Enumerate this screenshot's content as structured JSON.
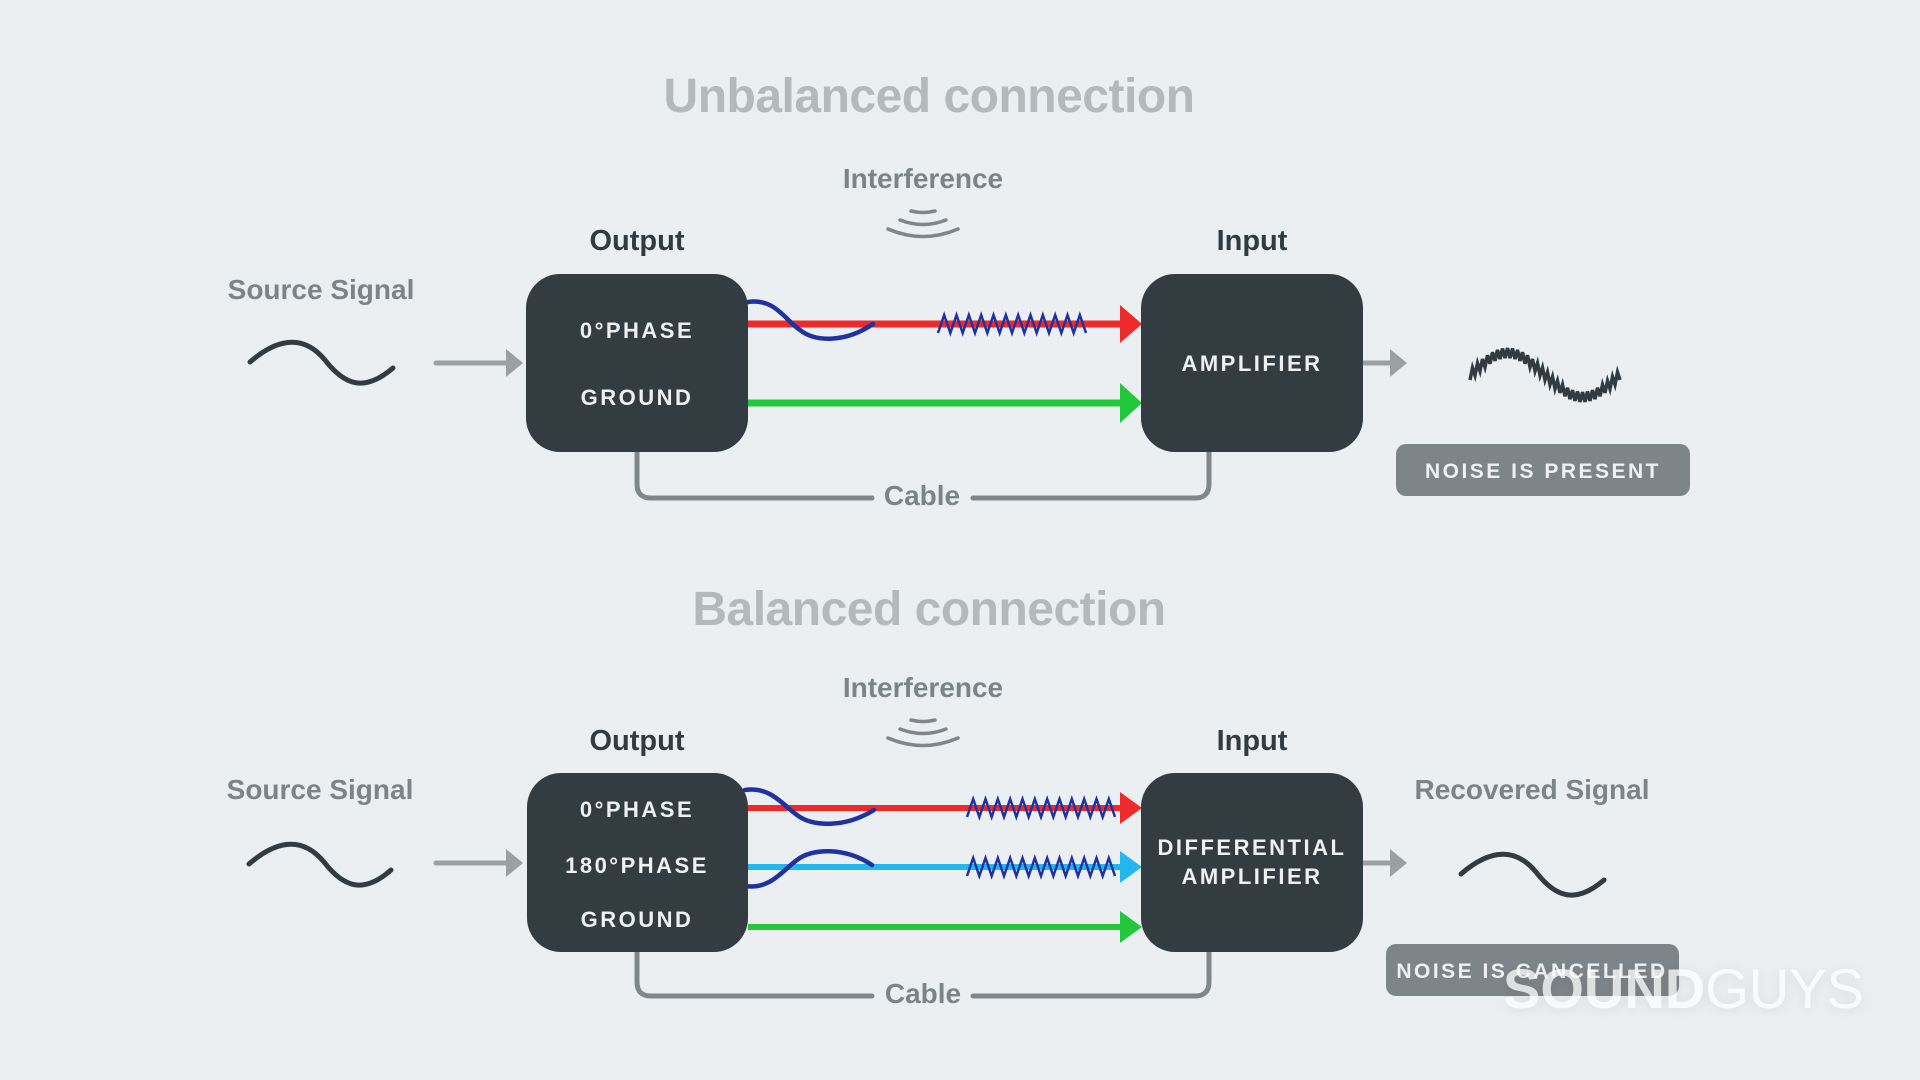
{
  "colors": {
    "background": "#ebeff2",
    "box": "#323c41",
    "title": "#b4b9bc",
    "label_grey": "#7d8488",
    "label_dark": "#323b40",
    "arrow_grey": "#9ba1a3",
    "cable": "#80878a",
    "badge": "#7e8588",
    "phase0_wire": "#ee2a2a",
    "phase180_wire": "#22b8ee",
    "ground_wire": "#22c83c",
    "noise": "#1f32a0"
  },
  "unbalanced": {
    "title": "Unbalanced connection",
    "interference_label": "Interference",
    "output_label": "Output",
    "input_label": "Input",
    "source_label": "Source Signal",
    "output_box": {
      "lines": [
        "0°PHASE",
        "GROUND"
      ]
    },
    "input_box": {
      "lines": [
        "AMPLIFIER"
      ]
    },
    "cable_label": "Cable",
    "result_badge": "NOISE IS PRESENT",
    "result_wave": "noisy-sine"
  },
  "balanced": {
    "title": "Balanced connection",
    "interference_label": "Interference",
    "output_label": "Output",
    "input_label": "Input",
    "source_label": "Source Signal",
    "output_box": {
      "lines": [
        "0°PHASE",
        "180°PHASE",
        "GROUND"
      ]
    },
    "input_box": {
      "lines": [
        "DIFFERENTIAL",
        "AMPLIFIER"
      ]
    },
    "cable_label": "Cable",
    "result_label": "Recovered Signal",
    "result_badge": "NOISE IS CANCELLED",
    "result_wave": "clean-sine"
  },
  "watermark": {
    "bold": "SOUND",
    "light": "GUYS"
  },
  "icons": {
    "interference": "radio-waves-icon",
    "source": "sine-wave-icon",
    "arrow": "arrow-right-icon",
    "noise": "zigzag-noise-icon"
  }
}
